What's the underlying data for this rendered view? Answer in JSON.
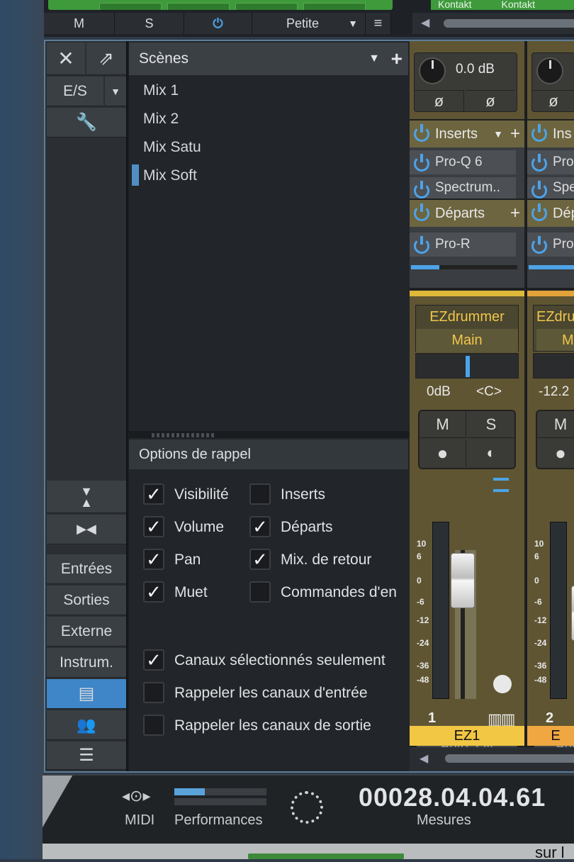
{
  "top_bar": {
    "buttons": [
      {
        "label": "M"
      },
      {
        "label": "S"
      },
      {
        "label": "⏻"
      },
      {
        "label": "Petite"
      }
    ],
    "kontakt_labels": [
      "Kontakt",
      "Kontakt"
    ]
  },
  "nav": {
    "es_label": "E/S",
    "items": [
      {
        "label": "Entrées"
      },
      {
        "label": "Sorties"
      },
      {
        "label": "Externe"
      },
      {
        "label": "Instrum."
      }
    ]
  },
  "scenes": {
    "title": "Scènes",
    "items": [
      {
        "label": "Mix 1"
      },
      {
        "label": "Mix 2"
      },
      {
        "label": "Mix Satu"
      },
      {
        "label": "Mix Soft",
        "selected": true
      }
    ]
  },
  "recall_options": {
    "title": "Options de rappel",
    "left": [
      {
        "label": "Visibilité",
        "checked": true
      },
      {
        "label": "Volume",
        "checked": true
      },
      {
        "label": "Pan",
        "checked": true
      },
      {
        "label": "Muet",
        "checked": true
      }
    ],
    "right": [
      {
        "label": "Inserts",
        "checked": false
      },
      {
        "label": "Départs",
        "checked": true
      },
      {
        "label": "Mix. de retour",
        "checked": true
      },
      {
        "label": "Commandes d'en",
        "checked": false
      }
    ],
    "bottom": [
      {
        "label": "Canaux sélectionnés seulement",
        "checked": true
      },
      {
        "label": "Rappeler les canaux d'entrée",
        "checked": false
      },
      {
        "label": "Rappeler les canaux de sortie",
        "checked": false
      }
    ]
  },
  "mixer": {
    "channel1": {
      "gain": "0.0 dB",
      "phase": "ø",
      "inserts_label": "Inserts",
      "inserts": [
        "Pro-Q 6",
        "Spectrum.."
      ],
      "sends_label": "Départs",
      "sends": [
        "Pro-R"
      ],
      "name": "EZdrummer",
      "output": "Main",
      "volume": "0dB",
      "pan": "<C>",
      "mute": "M",
      "solo": "S",
      "scale": [
        "10",
        "6",
        "0",
        "-6",
        "-12",
        "-24",
        "-36",
        "-48"
      ],
      "number": "1",
      "automation": "Auto: Off",
      "label": "EZ1"
    },
    "channel2": {
      "inserts_label": "Ins",
      "inserts": [
        "Pro",
        "Spe"
      ],
      "sends_label": "Dép",
      "sends": [
        "Pro"
      ],
      "name": "EZdru",
      "output": "M",
      "volume": "-12.2",
      "mute": "M",
      "scale": [
        "10",
        "6",
        "0",
        "-6",
        "-12",
        "-24",
        "-36",
        "-48"
      ],
      "number": "2",
      "automation": "Aut",
      "label": "E"
    }
  },
  "transport": {
    "midi_label": "MIDI",
    "performance_label": "Performances",
    "performance_level": 0.33,
    "time": "00028.04.04.61",
    "time_unit": "Mesures"
  },
  "desktop": {
    "bottom_text": "sur l"
  }
}
